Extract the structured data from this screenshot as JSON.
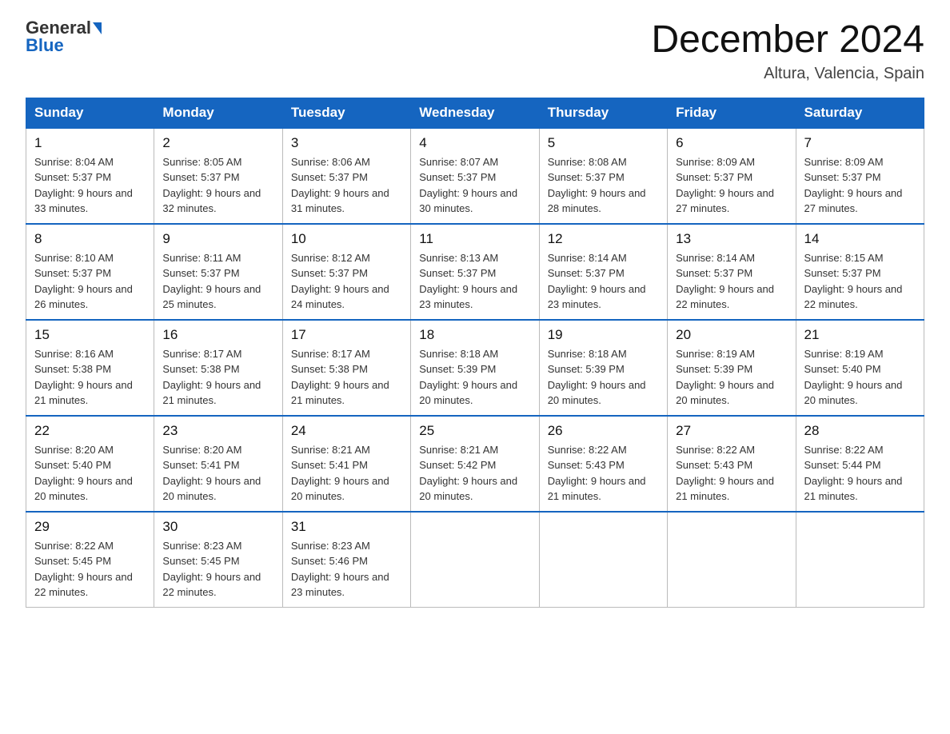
{
  "header": {
    "logo_general": "General",
    "logo_blue": "Blue",
    "month_year": "December 2024",
    "location": "Altura, Valencia, Spain"
  },
  "days_of_week": [
    "Sunday",
    "Monday",
    "Tuesday",
    "Wednesday",
    "Thursday",
    "Friday",
    "Saturday"
  ],
  "weeks": [
    [
      {
        "day": "1",
        "sunrise": "8:04 AM",
        "sunset": "5:37 PM",
        "daylight": "9 hours and 33 minutes."
      },
      {
        "day": "2",
        "sunrise": "8:05 AM",
        "sunset": "5:37 PM",
        "daylight": "9 hours and 32 minutes."
      },
      {
        "day": "3",
        "sunrise": "8:06 AM",
        "sunset": "5:37 PM",
        "daylight": "9 hours and 31 minutes."
      },
      {
        "day": "4",
        "sunrise": "8:07 AM",
        "sunset": "5:37 PM",
        "daylight": "9 hours and 30 minutes."
      },
      {
        "day": "5",
        "sunrise": "8:08 AM",
        "sunset": "5:37 PM",
        "daylight": "9 hours and 28 minutes."
      },
      {
        "day": "6",
        "sunrise": "8:09 AM",
        "sunset": "5:37 PM",
        "daylight": "9 hours and 27 minutes."
      },
      {
        "day": "7",
        "sunrise": "8:09 AM",
        "sunset": "5:37 PM",
        "daylight": "9 hours and 27 minutes."
      }
    ],
    [
      {
        "day": "8",
        "sunrise": "8:10 AM",
        "sunset": "5:37 PM",
        "daylight": "9 hours and 26 minutes."
      },
      {
        "day": "9",
        "sunrise": "8:11 AM",
        "sunset": "5:37 PM",
        "daylight": "9 hours and 25 minutes."
      },
      {
        "day": "10",
        "sunrise": "8:12 AM",
        "sunset": "5:37 PM",
        "daylight": "9 hours and 24 minutes."
      },
      {
        "day": "11",
        "sunrise": "8:13 AM",
        "sunset": "5:37 PM",
        "daylight": "9 hours and 23 minutes."
      },
      {
        "day": "12",
        "sunrise": "8:14 AM",
        "sunset": "5:37 PM",
        "daylight": "9 hours and 23 minutes."
      },
      {
        "day": "13",
        "sunrise": "8:14 AM",
        "sunset": "5:37 PM",
        "daylight": "9 hours and 22 minutes."
      },
      {
        "day": "14",
        "sunrise": "8:15 AM",
        "sunset": "5:37 PM",
        "daylight": "9 hours and 22 minutes."
      }
    ],
    [
      {
        "day": "15",
        "sunrise": "8:16 AM",
        "sunset": "5:38 PM",
        "daylight": "9 hours and 21 minutes."
      },
      {
        "day": "16",
        "sunrise": "8:17 AM",
        "sunset": "5:38 PM",
        "daylight": "9 hours and 21 minutes."
      },
      {
        "day": "17",
        "sunrise": "8:17 AM",
        "sunset": "5:38 PM",
        "daylight": "9 hours and 21 minutes."
      },
      {
        "day": "18",
        "sunrise": "8:18 AM",
        "sunset": "5:39 PM",
        "daylight": "9 hours and 20 minutes."
      },
      {
        "day": "19",
        "sunrise": "8:18 AM",
        "sunset": "5:39 PM",
        "daylight": "9 hours and 20 minutes."
      },
      {
        "day": "20",
        "sunrise": "8:19 AM",
        "sunset": "5:39 PM",
        "daylight": "9 hours and 20 minutes."
      },
      {
        "day": "21",
        "sunrise": "8:19 AM",
        "sunset": "5:40 PM",
        "daylight": "9 hours and 20 minutes."
      }
    ],
    [
      {
        "day": "22",
        "sunrise": "8:20 AM",
        "sunset": "5:40 PM",
        "daylight": "9 hours and 20 minutes."
      },
      {
        "day": "23",
        "sunrise": "8:20 AM",
        "sunset": "5:41 PM",
        "daylight": "9 hours and 20 minutes."
      },
      {
        "day": "24",
        "sunrise": "8:21 AM",
        "sunset": "5:41 PM",
        "daylight": "9 hours and 20 minutes."
      },
      {
        "day": "25",
        "sunrise": "8:21 AM",
        "sunset": "5:42 PM",
        "daylight": "9 hours and 20 minutes."
      },
      {
        "day": "26",
        "sunrise": "8:22 AM",
        "sunset": "5:43 PM",
        "daylight": "9 hours and 21 minutes."
      },
      {
        "day": "27",
        "sunrise": "8:22 AM",
        "sunset": "5:43 PM",
        "daylight": "9 hours and 21 minutes."
      },
      {
        "day": "28",
        "sunrise": "8:22 AM",
        "sunset": "5:44 PM",
        "daylight": "9 hours and 21 minutes."
      }
    ],
    [
      {
        "day": "29",
        "sunrise": "8:22 AM",
        "sunset": "5:45 PM",
        "daylight": "9 hours and 22 minutes."
      },
      {
        "day": "30",
        "sunrise": "8:23 AM",
        "sunset": "5:45 PM",
        "daylight": "9 hours and 22 minutes."
      },
      {
        "day": "31",
        "sunrise": "8:23 AM",
        "sunset": "5:46 PM",
        "daylight": "9 hours and 23 minutes."
      },
      null,
      null,
      null,
      null
    ]
  ]
}
